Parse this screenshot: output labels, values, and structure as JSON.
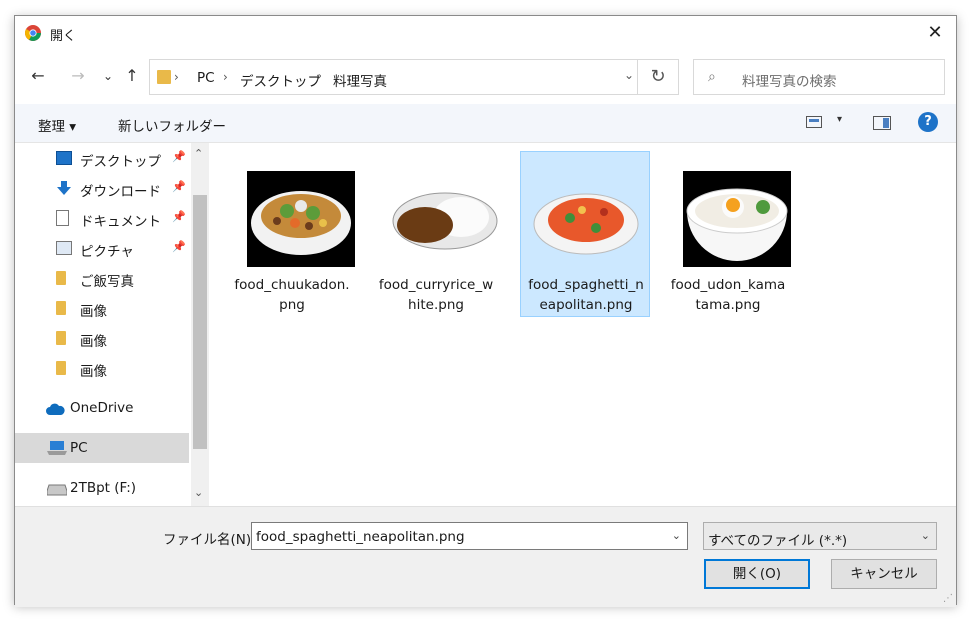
{
  "window": {
    "title": "開く",
    "close": "✕"
  },
  "nav": {
    "back": "←",
    "forward": "→",
    "recent": "⌄",
    "up": "↑"
  },
  "address": {
    "crumbs": [
      "PC",
      "デスクトップ",
      "料理写真"
    ],
    "sep": "›",
    "dropdown": "⌄",
    "refresh": "↻"
  },
  "search": {
    "icon": "⌕",
    "placeholder": "料理写真の検索"
  },
  "toolbar": {
    "organize": "整理 ▾",
    "new_folder": "新しいフォルダー",
    "view_dropdown": "▾",
    "help": "?"
  },
  "sidebar": {
    "pin": "📌",
    "items": [
      {
        "label": "デスクトップ",
        "icon": "desktop-icon",
        "pinned": true
      },
      {
        "label": "ダウンロード",
        "icon": "download-icon",
        "pinned": true
      },
      {
        "label": "ドキュメント",
        "icon": "document-icon",
        "pinned": true
      },
      {
        "label": "ピクチャ",
        "icon": "pictures-icon",
        "pinned": true
      },
      {
        "label": "ご飯写真",
        "icon": "folder-icon",
        "pinned": false
      },
      {
        "label": "画像",
        "icon": "folder-icon",
        "pinned": false
      },
      {
        "label": "画像",
        "icon": "folder-icon",
        "pinned": false
      },
      {
        "label": "画像",
        "icon": "folder-icon",
        "pinned": false
      },
      {
        "label": "OneDrive",
        "icon": "cloud-icon",
        "pinned": false
      },
      {
        "label": "PC",
        "icon": "pc-icon",
        "pinned": false,
        "selected": true
      },
      {
        "label": "2TBpt (F:)",
        "icon": "drive-icon",
        "pinned": false
      }
    ],
    "scroll_up": "⌃",
    "scroll_down": "⌄"
  },
  "files": [
    {
      "name": "food_chuukadon.png",
      "display": "food_chuukadon.\npng",
      "selected": false
    },
    {
      "name": "food_curryrice_white.png",
      "display": "food_curryrice_w\nhite.png",
      "selected": false
    },
    {
      "name": "food_spaghetti_neapolitan.png",
      "display": "food_spaghetti_n\neapolitan.png",
      "selected": true
    },
    {
      "name": "food_udon_kamatama.png",
      "display": "food_udon_kama\ntama.png",
      "selected": false
    }
  ],
  "bottom": {
    "filename_label": "ファイル名(N):",
    "filename_value": "food_spaghetti_neapolitan.png",
    "filetype": "すべてのファイル (*.*)",
    "dropdown": "⌄",
    "open": "開く(O)",
    "cancel": "キャンセル",
    "resize_grip": "⋰"
  },
  "colors": {
    "selection": "#cce8ff",
    "selection_border": "#99d1ff",
    "accent": "#0078d7",
    "folder": "#e9b949"
  }
}
